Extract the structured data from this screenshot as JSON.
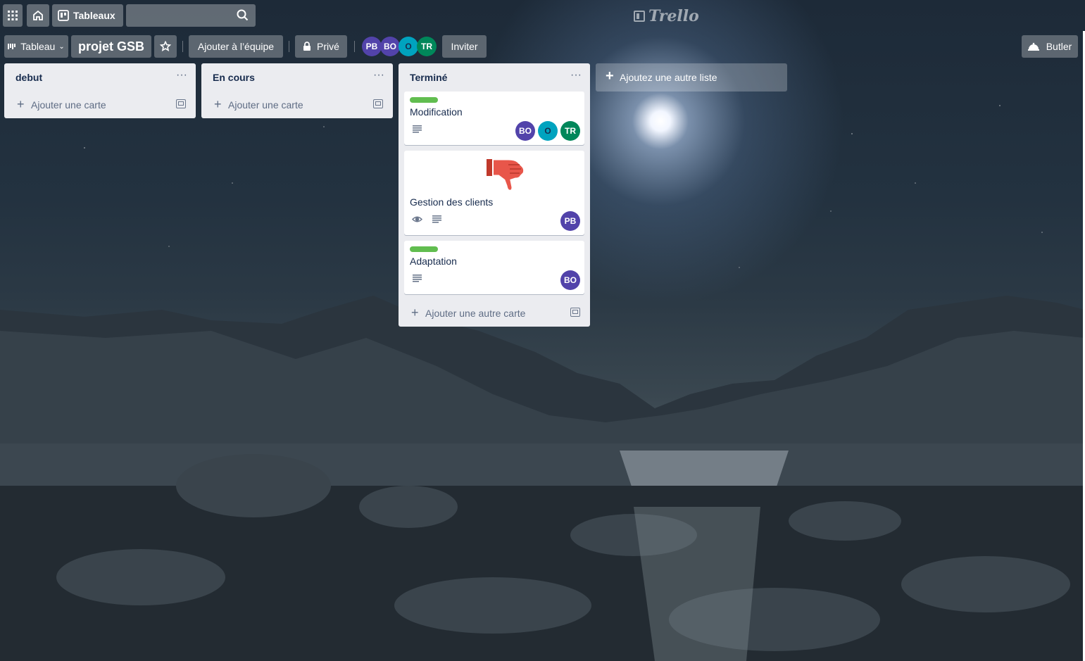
{
  "header": {
    "apps_icon": "grid-icon",
    "home_icon": "home-icon",
    "boards_label": "Tableaux",
    "search_value": "",
    "search_icon": "search-icon",
    "logo_text": "Trello"
  },
  "board_bar": {
    "view_label": "Tableau",
    "board_name": "projet GSB",
    "star_icon": "star-icon",
    "team_label": "Ajouter à l’équipe",
    "privacy_label": "Privé",
    "members": [
      {
        "initials": "PB",
        "color": "#5243aa"
      },
      {
        "initials": "BO",
        "color": "#5243aa"
      },
      {
        "initials": "O",
        "color": "#00a3bf"
      },
      {
        "initials": "TR",
        "color": "#00875a"
      }
    ],
    "invite_label": "Inviter",
    "butler_label": "Butler"
  },
  "lists": [
    {
      "title": "debut",
      "menu": "···",
      "add_card_label": "Ajouter une carte"
    },
    {
      "title": "En cours",
      "menu": "···",
      "add_card_label": "Ajouter une carte"
    },
    {
      "title": "Terminé",
      "menu": "···",
      "add_card_label": "Ajouter une autre carte",
      "cards": [
        {
          "title": "Modification",
          "label_color": "#61bd4f",
          "members": [
            "BO",
            "O",
            "TR"
          ]
        },
        {
          "title": "Gestion des clients",
          "sticker": "thumbs-down",
          "members": [
            "PB"
          ]
        },
        {
          "title": "Adaptation",
          "label_color": "#61bd4f",
          "members": [
            "BO"
          ]
        }
      ]
    }
  ],
  "add_list_label": "Ajoutez une autre liste"
}
